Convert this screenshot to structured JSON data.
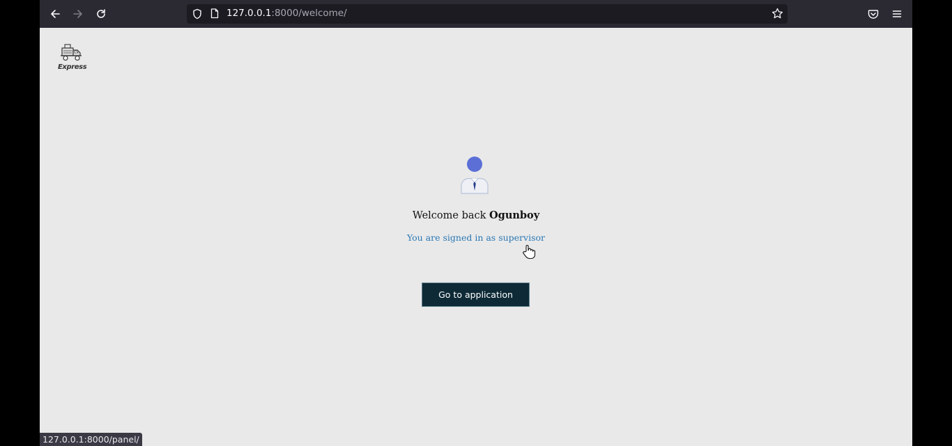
{
  "browser": {
    "url_host": "127.0.0.1",
    "url_rest": ":8000/welcome/",
    "status_url": "127.0.0.1:8000/panel/",
    "icons": [
      "back-icon",
      "forward-icon",
      "reload-icon",
      "shield-icon",
      "page-icon",
      "star-icon",
      "pocket-icon",
      "menu-icon"
    ]
  },
  "page": {
    "logo_text": "Express",
    "welcome_prefix": "Welcome back ",
    "user_name": "Ogunboy",
    "role_text": "You are signed in as supervisor",
    "button_label": "Go to application"
  },
  "colors": {
    "page_bg": "#e9e9e9",
    "link": "#2b78b4",
    "button_bg": "#0d2a36",
    "avatar": "#5b6fd6"
  }
}
